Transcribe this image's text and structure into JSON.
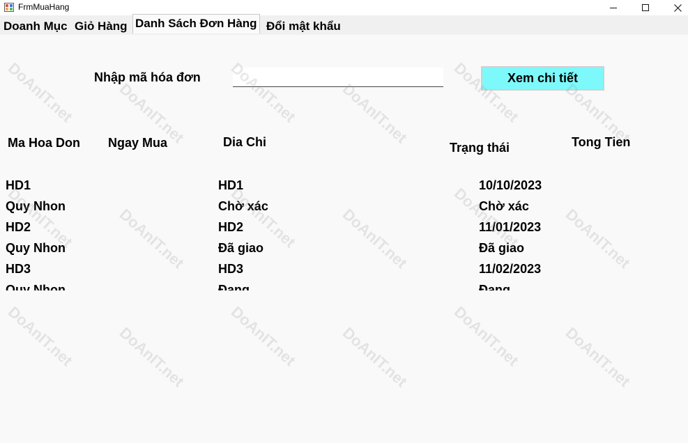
{
  "window": {
    "title": "FrmMuaHang"
  },
  "tabs": [
    {
      "label": "Doanh Mục"
    },
    {
      "label": "Giỏ Hàng"
    },
    {
      "label": "Danh Sách Đơn Hàng"
    },
    {
      "label": "Đổi mật khẩu"
    }
  ],
  "search": {
    "label": "Nhập mã hóa đơn",
    "value": ""
  },
  "view_button": {
    "label": "Xem chi tiết",
    "color": "#7df9fb"
  },
  "columns": [
    "Ma Hoa Don",
    "Ngay Mua",
    "Dia Chi",
    "Trạng thái",
    "Tong Tien"
  ],
  "rows": [
    {
      "left": "HD1",
      "middle": "HD1",
      "right": "10/10/2023"
    },
    {
      "left": "Quy Nhon",
      "middle": "Chờ xác",
      "right": "Chờ xác"
    },
    {
      "left": "HD2",
      "middle": "HD2",
      "right": "11/01/2023"
    },
    {
      "left": "Quy Nhon",
      "middle": "Đã giao",
      "right": "Đã giao"
    },
    {
      "left": "HD3",
      "middle": "HD3",
      "right": "11/02/2023"
    },
    {
      "left": "Quy Nhon",
      "middle": "Đang",
      "right": "Đang"
    }
  ],
  "watermark": {
    "text": "DoAnIT.net"
  }
}
